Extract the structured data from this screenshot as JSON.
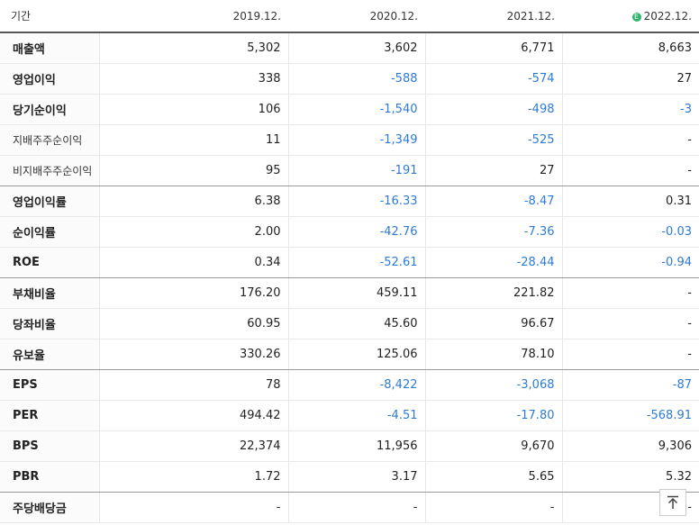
{
  "header": {
    "label": "기간",
    "periods": [
      "2019.12.",
      "2020.12.",
      "2021.12.",
      "2022.12."
    ],
    "estimate_badge": "E"
  },
  "rows": [
    {
      "label": "매출액",
      "sub": false,
      "values": [
        "5,302",
        "3,602",
        "6,771",
        "8,663"
      ]
    },
    {
      "label": "영업이익",
      "sub": false,
      "values": [
        "338",
        "-588",
        "-574",
        "27"
      ]
    },
    {
      "label": "당기순이익",
      "sub": false,
      "values": [
        "106",
        "-1,540",
        "-498",
        "-3"
      ]
    },
    {
      "label": "지배주주순이익",
      "sub": true,
      "values": [
        "11",
        "-1,349",
        "-525",
        "-"
      ]
    },
    {
      "label": "비지배주주순이익",
      "sub": true,
      "values": [
        "95",
        "-191",
        "27",
        "-"
      ]
    },
    {
      "label": "영업이익률",
      "sub": false,
      "values": [
        "6.38",
        "-16.33",
        "-8.47",
        "0.31"
      ]
    },
    {
      "label": "순이익률",
      "sub": false,
      "values": [
        "2.00",
        "-42.76",
        "-7.36",
        "-0.03"
      ]
    },
    {
      "label": "ROE",
      "sub": false,
      "values": [
        "0.34",
        "-52.61",
        "-28.44",
        "-0.94"
      ]
    },
    {
      "label": "부채비율",
      "sub": false,
      "values": [
        "176.20",
        "459.11",
        "221.82",
        "-"
      ]
    },
    {
      "label": "당좌비율",
      "sub": false,
      "values": [
        "60.95",
        "45.60",
        "96.67",
        "-"
      ]
    },
    {
      "label": "유보율",
      "sub": false,
      "values": [
        "330.26",
        "125.06",
        "78.10",
        "-"
      ]
    },
    {
      "label": "EPS",
      "sub": false,
      "values": [
        "78",
        "-8,422",
        "-3,068",
        "-87"
      ]
    },
    {
      "label": "PER",
      "sub": false,
      "values": [
        "494.42",
        "-4.51",
        "-17.80",
        "-568.91"
      ]
    },
    {
      "label": "BPS",
      "sub": false,
      "values": [
        "22,374",
        "11,956",
        "9,670",
        "9,306"
      ]
    },
    {
      "label": "PBR",
      "sub": false,
      "values": [
        "1.72",
        "3.17",
        "5.65",
        "5.32"
      ]
    },
    {
      "label": "주당배당금",
      "sub": false,
      "values": [
        "-",
        "-",
        "-",
        "-"
      ]
    }
  ],
  "group_end_rows": [
    4,
    7,
    10,
    14
  ],
  "colors": {
    "negative": "#2e7bd4",
    "estimate_badge": "#2fb36b"
  },
  "scroll_top_icon": "arrow-up-to-top-icon"
}
